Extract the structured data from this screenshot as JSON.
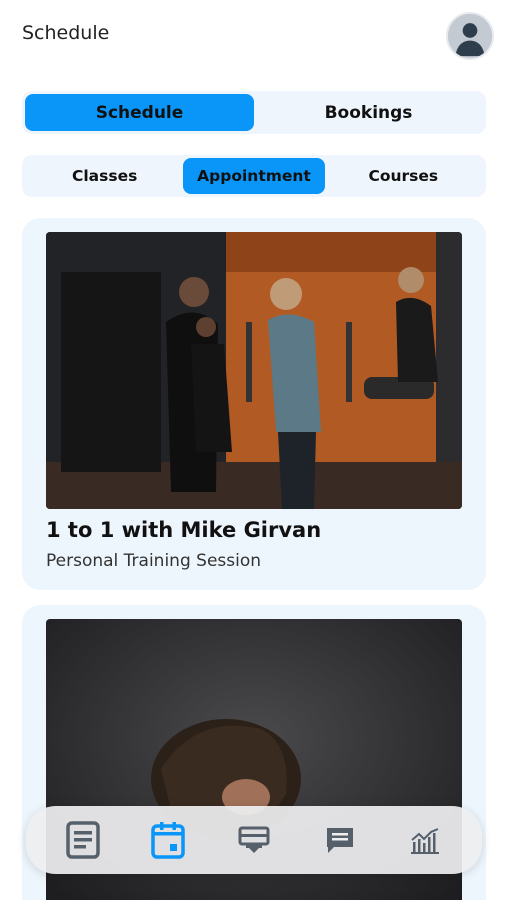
{
  "header": {
    "title": "Schedule"
  },
  "main_tabs": [
    {
      "label": "Schedule",
      "active": true
    },
    {
      "label": "Bookings",
      "active": false
    }
  ],
  "sub_tabs": [
    {
      "label": "Classes",
      "active": false
    },
    {
      "label": "Appointment",
      "active": true
    },
    {
      "label": "Courses",
      "active": false
    }
  ],
  "cards": [
    {
      "title": "1 to 1 with Mike Girvan",
      "subtitle": "Personal Training Session",
      "image": "gym-training-photo"
    },
    {
      "image": "portrait-photo-man"
    }
  ],
  "bottom_nav": [
    {
      "icon": "document-icon",
      "active": false
    },
    {
      "icon": "calendar-icon",
      "active": true
    },
    {
      "icon": "training-board-icon",
      "active": false
    },
    {
      "icon": "chat-icon",
      "active": false
    },
    {
      "icon": "chart-icon",
      "active": false
    }
  ],
  "colors": {
    "accent": "#0a95f8",
    "tab_bg": "#eef5fc",
    "card_bg": "#eef6fd",
    "icon_gray": "#55606b"
  }
}
